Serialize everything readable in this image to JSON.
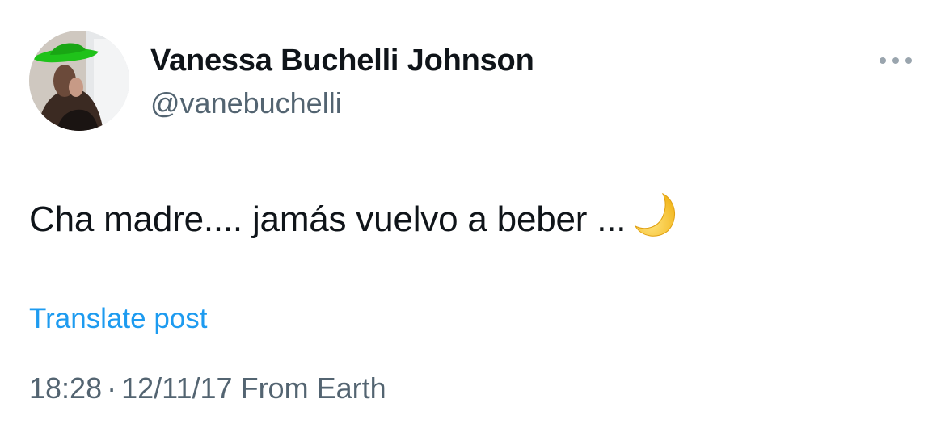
{
  "author": {
    "display_name": "Vanessa Buchelli Johnson",
    "handle": "@vanebuchelli",
    "avatar_icon": "user-avatar-photo"
  },
  "more_icon": "more-horizontal-icon",
  "post": {
    "text": "Cha madre.... jamás vuelvo a beber ...",
    "emoji_icon": "crescent-moon-icon"
  },
  "translate_label": "Translate post",
  "meta": {
    "time": "18:28",
    "separator": "·",
    "date": "12/11/17",
    "source": "From Earth"
  },
  "colors": {
    "text": "#0f1419",
    "secondary": "#536471",
    "link": "#1d9bf0",
    "moon": "#f4c430"
  }
}
